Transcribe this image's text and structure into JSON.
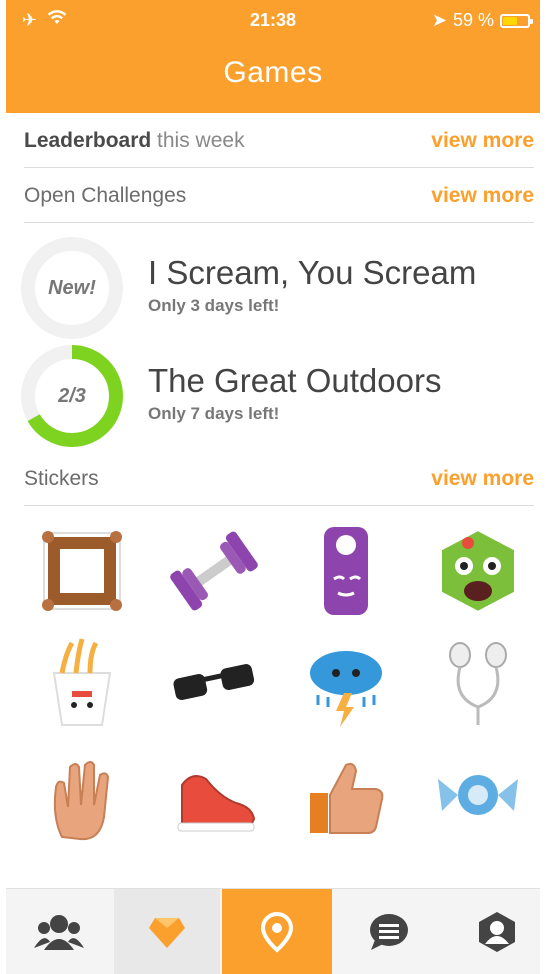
{
  "status": {
    "time": "21:38",
    "battery": "59 %"
  },
  "header": {
    "title": "Games"
  },
  "leaderboard": {
    "label_bold": "Leaderboard",
    "label_light": "this week",
    "more": "view more"
  },
  "open_challenges": {
    "label": "Open Challenges",
    "more": "view more"
  },
  "challenges": [
    {
      "badge": "New!",
      "title": "I Scream, You Scream",
      "subtitle": "Only 3 days left!",
      "progress": 0
    },
    {
      "badge": "2/3",
      "title": "The Great Outdoors",
      "subtitle": "Only 7 days left!",
      "progress": 0.667
    }
  ],
  "stickers": {
    "label": "Stickers",
    "more": "view more",
    "items": [
      "picture-frame-icon",
      "dumbbell-icon",
      "door-hanger-icon",
      "zombie-face-icon",
      "noodle-box-icon",
      "sunglasses-icon",
      "storm-cloud-icon",
      "earphones-icon",
      "waving-hand-icon",
      "sneaker-icon",
      "thumbs-up-icon",
      "candy-icon"
    ]
  },
  "tabbar": {
    "items": [
      "friends-icon",
      "diamond-icon",
      "location-icon",
      "chat-icon",
      "profile-icon"
    ]
  },
  "colors": {
    "accent": "#fba02d",
    "progress": "#7ed321",
    "ring_bg": "#f1f1f1"
  }
}
